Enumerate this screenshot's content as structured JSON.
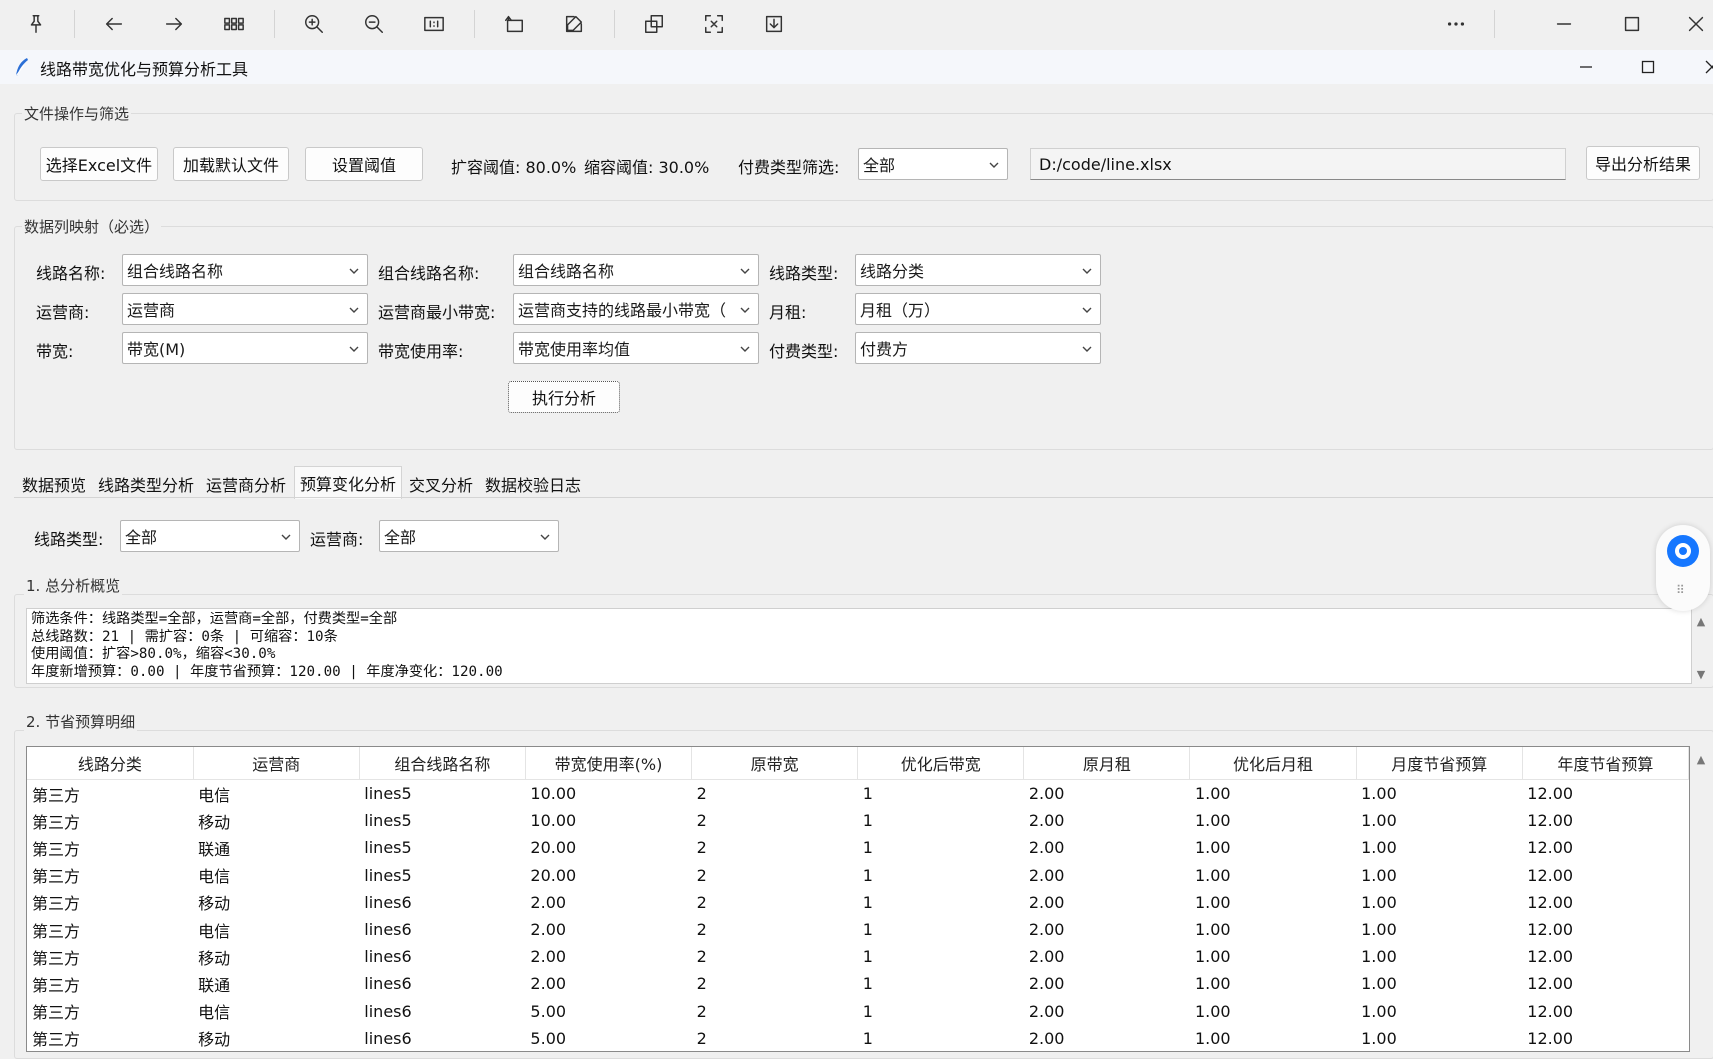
{
  "viewer_toolbar": {
    "icons": [
      "pin-icon",
      "arrow-left-icon",
      "arrow-right-icon",
      "grid-icon",
      "zoom-in-icon",
      "zoom-out-icon",
      "actual-size-icon",
      "rotate-icon",
      "edit-icon",
      "extract-icon",
      "select-text-icon",
      "download-icon",
      "more-icon",
      "minimize-icon",
      "maximize-icon",
      "close-icon"
    ]
  },
  "window": {
    "title": "线路带宽优化与预算分析工具"
  },
  "file_ops": {
    "group_label": "文件操作与筛选",
    "select_excel_label": "选择Excel文件",
    "load_default_label": "加载默认文件",
    "set_threshold_label": "设置阈值",
    "expand_threshold_text": "扩容阈值: 80.0%",
    "shrink_threshold_text": "缩容阈值: 30.0%",
    "pay_type_filter_label": "付费类型筛选:",
    "pay_type_filter_value": "全部",
    "file_path": "D:/code/line.xlsx",
    "export_label": "导出分析结果"
  },
  "mapping": {
    "group_label": "数据列映射（必选）",
    "fields": [
      {
        "label": "线路名称:",
        "value": "组合线路名称"
      },
      {
        "label": "组合线路名称:",
        "value": "组合线路名称"
      },
      {
        "label": "线路类型:",
        "value": "线路分类"
      },
      {
        "label": "运营商:",
        "value": "运营商"
      },
      {
        "label": "运营商最小带宽:",
        "value": "运营商支持的线路最小带宽（"
      },
      {
        "label": "月租:",
        "value": "月租（万）"
      },
      {
        "label": "带宽:",
        "value": "带宽(M)"
      },
      {
        "label": "带宽使用率:",
        "value": "带宽使用率均值"
      },
      {
        "label": "付费类型:",
        "value": "付费方"
      }
    ],
    "run_label": "执行分析"
  },
  "tabs": [
    {
      "label": "数据预览"
    },
    {
      "label": "线路类型分析"
    },
    {
      "label": "运营商分析"
    },
    {
      "label": "预算变化分析"
    },
    {
      "label": "交叉分析"
    },
    {
      "label": "数据校验日志"
    }
  ],
  "filters": {
    "line_type_label": "线路类型:",
    "line_type_value": "全部",
    "operator_label": "运营商:",
    "operator_value": "全部"
  },
  "overview": {
    "heading": "1. 总分析概览",
    "lines": [
      "筛选条件：线路类型=全部，运营商=全部，付费类型=全部",
      "总线路数：21 | 需扩容：0条 | 可缩容：10条",
      "使用阈值：扩容>80.0%，缩容<30.0%",
      "年度新增预算：0.00 | 年度节省预算：120.00 | 年度净变化：120.00"
    ]
  },
  "detail": {
    "heading": "2. 节省预算明细",
    "columns": [
      "线路分类",
      "运营商",
      "组合线路名称",
      "带宽使用率(%)",
      "原带宽",
      "优化后带宽",
      "原月租",
      "优化后月租",
      "月度节省预算",
      "年度节省预算"
    ],
    "rows": [
      [
        "第三方",
        "电信",
        "lines5",
        "10.00",
        "2",
        "1",
        "2.00",
        "1.00",
        "1.00",
        "12.00"
      ],
      [
        "第三方",
        "移动",
        "lines5",
        "10.00",
        "2",
        "1",
        "2.00",
        "1.00",
        "1.00",
        "12.00"
      ],
      [
        "第三方",
        "联通",
        "lines5",
        "20.00",
        "2",
        "1",
        "2.00",
        "1.00",
        "1.00",
        "12.00"
      ],
      [
        "第三方",
        "电信",
        "lines5",
        "20.00",
        "2",
        "1",
        "2.00",
        "1.00",
        "1.00",
        "12.00"
      ],
      [
        "第三方",
        "移动",
        "lines6",
        "2.00",
        "2",
        "1",
        "2.00",
        "1.00",
        "1.00",
        "12.00"
      ],
      [
        "第三方",
        "电信",
        "lines6",
        "2.00",
        "2",
        "1",
        "2.00",
        "1.00",
        "1.00",
        "12.00"
      ],
      [
        "第三方",
        "移动",
        "lines6",
        "2.00",
        "2",
        "1",
        "2.00",
        "1.00",
        "1.00",
        "12.00"
      ],
      [
        "第三方",
        "联通",
        "lines6",
        "2.00",
        "2",
        "1",
        "2.00",
        "1.00",
        "1.00",
        "12.00"
      ],
      [
        "第三方",
        "电信",
        "lines6",
        "5.00",
        "2",
        "1",
        "2.00",
        "1.00",
        "1.00",
        "12.00"
      ],
      [
        "第三方",
        "移动",
        "lines6",
        "5.00",
        "2",
        "1",
        "2.00",
        "1.00",
        "1.00",
        "12.00"
      ]
    ]
  },
  "colors": {
    "accent": "#1677ff",
    "window_bg": "#f0f0f0"
  }
}
